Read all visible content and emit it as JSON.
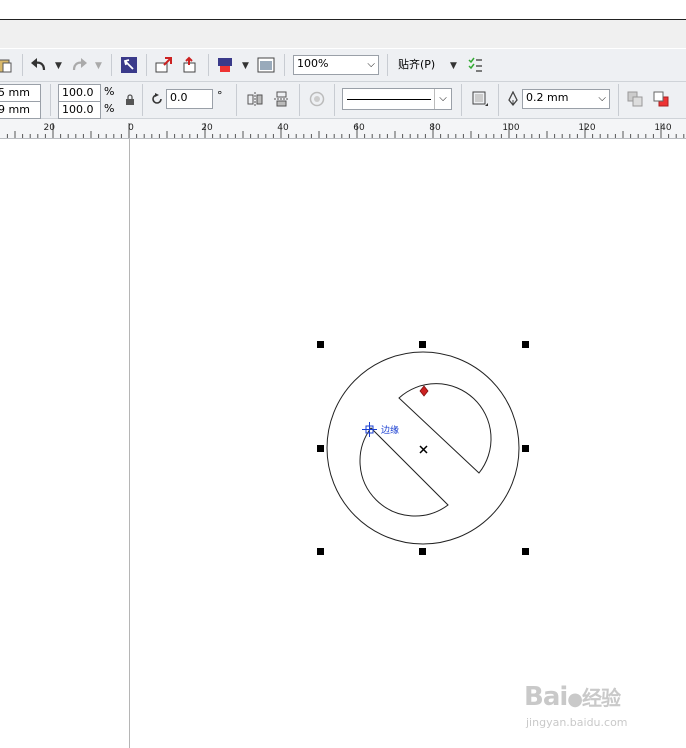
{
  "toolbar1": {
    "zoom_value": "100%",
    "snap_label": "贴齐(P)"
  },
  "toolbar2": {
    "pos_x_fragment": "5 mm",
    "pos_y_fragment": "9 mm",
    "scale_x": "100.0",
    "scale_y": "100.0",
    "percent_sign": "%",
    "rotation_value": "0.0",
    "degree_sign": "°",
    "outline_width": "0.2 mm"
  },
  "ruler": {
    "labels": [
      "20",
      "0",
      "20",
      "40",
      "60",
      "80",
      "100",
      "120",
      "140"
    ]
  },
  "canvas": {
    "node_label": "边缘"
  },
  "watermark": {
    "logo_text": "Bai",
    "logo_suffix": "经验",
    "url": "jingyan.baidu.com"
  },
  "colors": {
    "toolbar_bg": "#eef0f3",
    "node_red": "#cc2222",
    "node_blue": "#1a3fd1"
  }
}
